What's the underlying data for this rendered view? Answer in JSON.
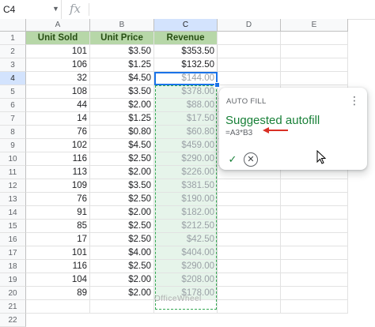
{
  "formula_bar": {
    "name_box": "C4",
    "fx_label": "fx"
  },
  "columns": [
    "A",
    "B",
    "C",
    "D",
    "E"
  ],
  "rows": [
    "1",
    "2",
    "3",
    "4",
    "5",
    "6",
    "7",
    "8",
    "9",
    "10",
    "11",
    "12",
    "13",
    "14",
    "15",
    "16",
    "17",
    "18",
    "19",
    "20",
    "21",
    "22"
  ],
  "header": {
    "a": "Unit Sold",
    "b": "Unit Price",
    "c": "Revenue"
  },
  "data": [
    {
      "a": "101",
      "b": "$3.50",
      "c": "$353.50"
    },
    {
      "a": "106",
      "b": "$1.25",
      "c": "$132.50"
    },
    {
      "a": "32",
      "b": "$4.50",
      "c": "$144.00"
    },
    {
      "a": "108",
      "b": "$3.50",
      "c": "$378.00"
    },
    {
      "a": "44",
      "b": "$2.00",
      "c": "$88.00"
    },
    {
      "a": "14",
      "b": "$1.25",
      "c": "$17.50"
    },
    {
      "a": "76",
      "b": "$0.80",
      "c": "$60.80"
    },
    {
      "a": "102",
      "b": "$4.50",
      "c": "$459.00"
    },
    {
      "a": "116",
      "b": "$2.50",
      "c": "$290.00"
    },
    {
      "a": "113",
      "b": "$2.00",
      "c": "$226.00"
    },
    {
      "a": "109",
      "b": "$3.50",
      "c": "$381.50"
    },
    {
      "a": "76",
      "b": "$2.50",
      "c": "$190.00"
    },
    {
      "a": "91",
      "b": "$2.00",
      "c": "$182.00"
    },
    {
      "a": "85",
      "b": "$2.50",
      "c": "$212.50"
    },
    {
      "a": "17",
      "b": "$2.50",
      "c": "$42.50"
    },
    {
      "a": "101",
      "b": "$4.00",
      "c": "$404.00"
    },
    {
      "a": "116",
      "b": "$2.50",
      "c": "$290.00"
    },
    {
      "a": "104",
      "b": "$2.00",
      "c": "$208.00"
    },
    {
      "a": "89",
      "b": "$2.00",
      "c": "$178.00"
    }
  ],
  "popup": {
    "title": "AUTO FILL",
    "menu_icon": "more-vert-icon",
    "text": "Suggested autofill",
    "formula": "=A3*B3",
    "accept_icon": "check-icon",
    "dismiss_icon": "close-icon"
  },
  "watermark": "OfficeWheel",
  "colors": {
    "header_fill": "#b7d7a8",
    "suggestion_fill": "#e6f4ea",
    "selection_blue": "#1a73e8",
    "suggest_text_green": "#188038",
    "arrow_red": "#d93025"
  }
}
